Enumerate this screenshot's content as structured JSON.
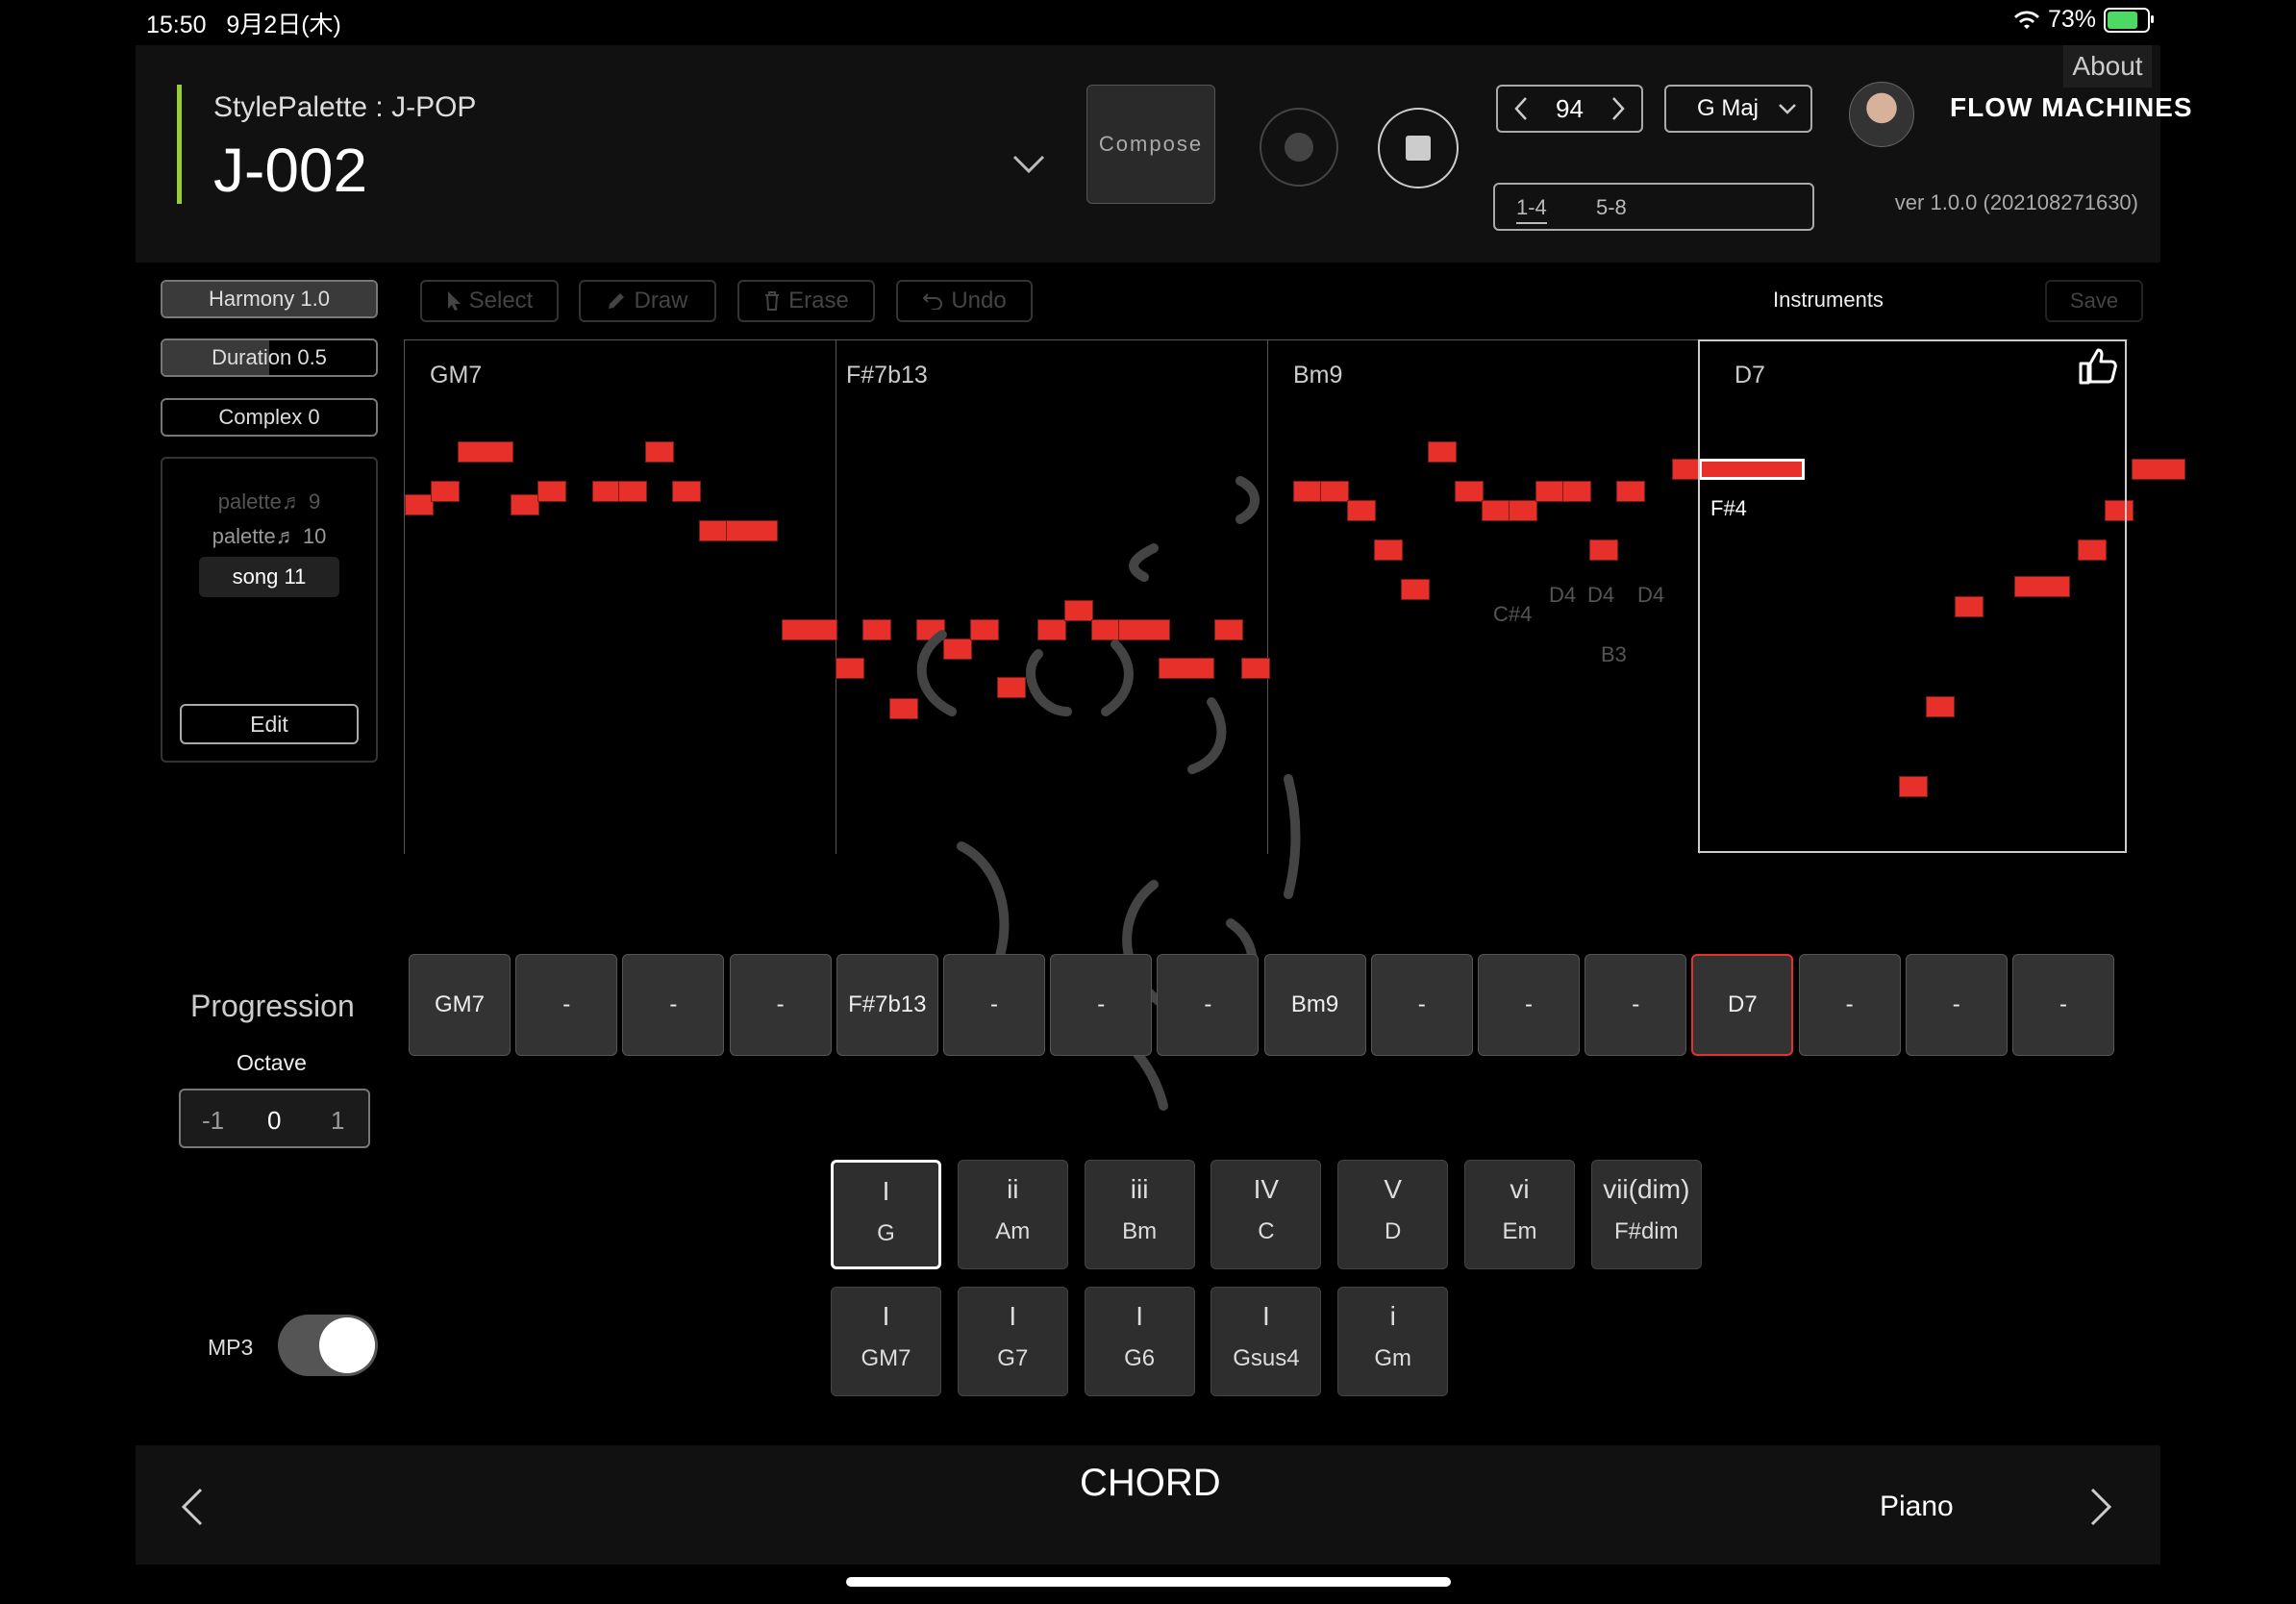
{
  "status": {
    "time": "15:50",
    "date": "9月2日(木)",
    "battery": "73%"
  },
  "header": {
    "style_palette": "StylePalette : J-POP",
    "song_title": "J-002",
    "compose_label": "Compose",
    "tempo": "94",
    "key": "G Maj",
    "bar_ranges": [
      "1-4",
      "5-8"
    ],
    "logo": "FLOW MACHINES",
    "about_label": "About",
    "version": "ver 1.0.0 (202108271630)"
  },
  "params": {
    "harmony": {
      "label": "Harmony 1.0",
      "level": 1.0
    },
    "duration": {
      "label": "Duration 0.5",
      "level": 0.5
    },
    "complex": {
      "label": "Complex 0",
      "level": 0.0
    }
  },
  "palette": {
    "items": [
      "palette♬ 9",
      "palette♬ 10",
      "song 11"
    ],
    "selected": "song 11",
    "edit_label": "Edit"
  },
  "toolbar": {
    "select": "Select",
    "draw": "Draw",
    "erase": "Erase",
    "undo": "Undo",
    "instruments": "Instruments",
    "save": "Save"
  },
  "roll": {
    "chords": [
      "GM7",
      "F#7b13",
      "Bm9",
      "D7"
    ],
    "labels": {
      "f4": "F#4",
      "d4a": "D4",
      "d4b": "D4",
      "d4c": "D4",
      "c4": "C#4",
      "b3": "B3"
    }
  },
  "progression": {
    "title": "Progression",
    "octave_title": "Octave",
    "octave": [
      "-1",
      "0",
      "1"
    ],
    "cells": [
      "GM7",
      "-",
      "-",
      "-",
      "F#7b13",
      "-",
      "-",
      "-",
      "Bm9",
      "-",
      "-",
      "-",
      "D7",
      "-",
      "-",
      "-"
    ]
  },
  "chord_palette": {
    "row1": [
      {
        "degree": "I",
        "name": "G"
      },
      {
        "degree": "ii",
        "name": "Am"
      },
      {
        "degree": "iii",
        "name": "Bm"
      },
      {
        "degree": "IV",
        "name": "C"
      },
      {
        "degree": "V",
        "name": "D"
      },
      {
        "degree": "vi",
        "name": "Em"
      },
      {
        "degree": "vii(dim)",
        "name": "F#dim"
      }
    ],
    "row2": [
      {
        "degree": "I",
        "name": "GM7"
      },
      {
        "degree": "I",
        "name": "G7"
      },
      {
        "degree": "I",
        "name": "G6"
      },
      {
        "degree": "I",
        "name": "Gsus4"
      },
      {
        "degree": "i",
        "name": "Gm"
      }
    ]
  },
  "mp3": {
    "label": "MP3",
    "on": true
  },
  "footer": {
    "mode": "CHORD",
    "instrument": "Piano"
  },
  "colors": {
    "note": "#e8302a",
    "accent_bar": "#9acd32",
    "selected_cell": "#e8302a"
  }
}
